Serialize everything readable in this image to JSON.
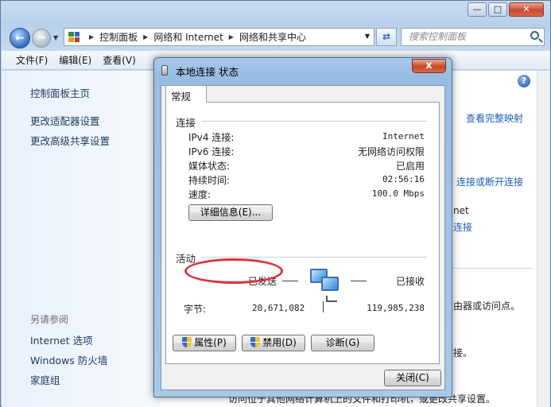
{
  "explorer": {
    "titlebar": {
      "minimize": "—",
      "maximize": "□",
      "close": "✕"
    },
    "address": {
      "crumbs": [
        "控制面板",
        "网络和 Internet",
        "网络和共享中心"
      ]
    },
    "search": {
      "placeholder": "搜索控制面板"
    },
    "menu": {
      "file": "文件(F)",
      "edit": "编辑(E)",
      "view": "查看(V)"
    },
    "left_pane": {
      "home": "控制面板主页",
      "links": [
        "更改适配器设置",
        "更改高级共享设置"
      ],
      "see_also_header": "另请参阅",
      "see_also": [
        "Internet 选项",
        "Windows 防火墙",
        "家庭组"
      ]
    },
    "right_pane": {
      "view_full_map": "查看完整映射",
      "connect_disconnect": "连接或断开连接",
      "partial_net": "net",
      "partial_link": "连接",
      "partial_text_1": "由器或访问点。",
      "partial_text_2": "接。",
      "partial_text_3": "访问位于其他网络计算机上的文件和打印机，或更改共享设置。"
    },
    "help_label": "?"
  },
  "dialog": {
    "title": "本地连接 状态",
    "close_label": "x",
    "tab": "常规",
    "connection": {
      "header": "连接",
      "rows": [
        {
          "label": "IPv4 连接:",
          "value": "Internet"
        },
        {
          "label": "IPv6 连接:",
          "value": "无网络访问权限"
        },
        {
          "label": "媒体状态:",
          "value": "已启用"
        },
        {
          "label": "持续时间:",
          "value": "02:56:16"
        },
        {
          "label": "速度:",
          "value": "100.0 Mbps"
        }
      ],
      "details_button": "详细信息(E)..."
    },
    "activity": {
      "header": "活动",
      "sent_label": "已发送",
      "received_label": "已接收",
      "bytes_label": "字节:",
      "bytes_sent": "20,671,082",
      "bytes_received": "119,985,238"
    },
    "buttons": {
      "properties": "属性(P)",
      "disable": "禁用(D)",
      "diagnose": "诊断(G)",
      "close": "关闭(C)"
    }
  },
  "colors": {
    "link": "#1d5fb5",
    "highlight_ring": "#e0313a",
    "dialog_frame": "#a9c9ea"
  },
  "icons": [
    "back-arrow-icon",
    "forward-arrow-icon",
    "control-panel-icon",
    "refresh-icon",
    "search-icon",
    "help-icon",
    "network-adapter-icon",
    "network-computers-icon",
    "uac-shield-icon"
  ]
}
